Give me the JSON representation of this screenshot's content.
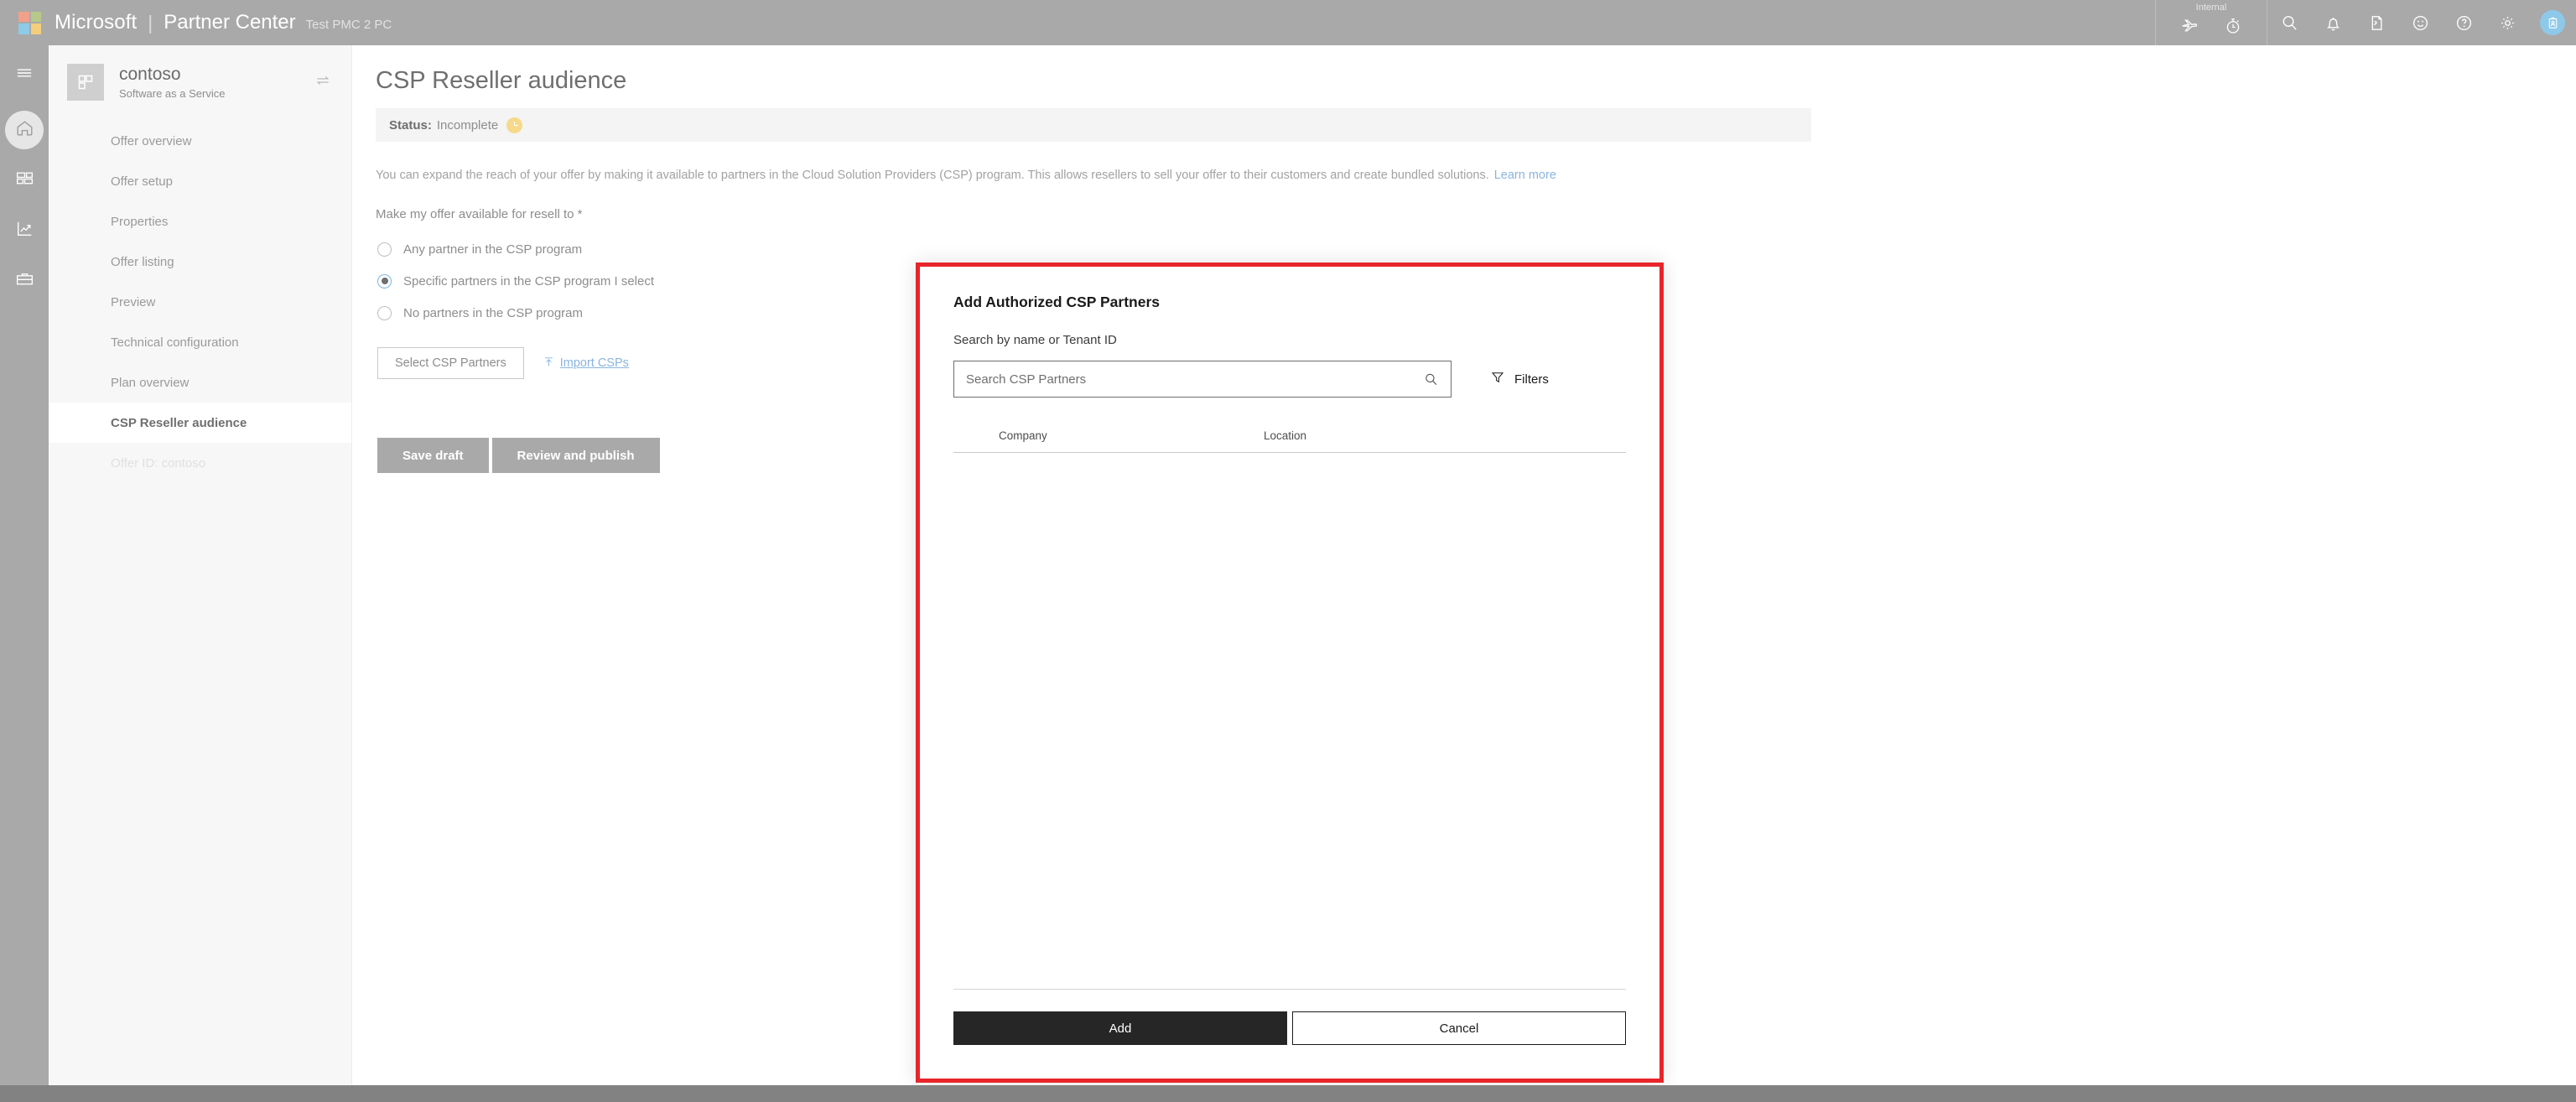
{
  "topbar": {
    "brand_microsoft": "Microsoft",
    "brand_separator": "|",
    "brand_product": "Partner Center",
    "environment": "Test PMC 2 PC",
    "internal_label": "Internal",
    "icons": [
      {
        "name": "airplane-icon",
        "group": "internal"
      },
      {
        "name": "stopwatch-icon",
        "group": "internal"
      },
      {
        "name": "search-icon",
        "group": "main"
      },
      {
        "name": "bell-notification-icon",
        "group": "main"
      },
      {
        "name": "document-feedback-icon",
        "group": "main"
      },
      {
        "name": "smiley-feedback-icon",
        "group": "main"
      },
      {
        "name": "help-question-icon",
        "group": "main"
      },
      {
        "name": "gear-settings-icon",
        "group": "main"
      },
      {
        "name": "avatar-badge-icon",
        "group": "main"
      }
    ]
  },
  "rail": {
    "items": [
      {
        "label": "Menu",
        "icon": "hamburger-menu-icon",
        "active": false
      },
      {
        "label": "Home",
        "icon": "home-icon",
        "active": true
      },
      {
        "label": "Dashboard",
        "icon": "dashboard-grid-icon",
        "active": false
      },
      {
        "label": "Analytics",
        "icon": "analytics-chart-icon",
        "active": false
      },
      {
        "label": "Tools",
        "icon": "toolbox-icon",
        "active": false
      }
    ]
  },
  "sidebar": {
    "offer_name": "contoso",
    "offer_type": "Software as a Service",
    "swap_icon": "swap-arrows-icon",
    "items": [
      {
        "label": "Offer overview",
        "state": "normal"
      },
      {
        "label": "Offer setup",
        "state": "normal"
      },
      {
        "label": "Properties",
        "state": "normal"
      },
      {
        "label": "Offer listing",
        "state": "normal"
      },
      {
        "label": "Preview",
        "state": "normal"
      },
      {
        "label": "Technical configuration",
        "state": "normal"
      },
      {
        "label": "Plan overview",
        "state": "normal"
      },
      {
        "label": "CSP Reseller audience",
        "state": "active"
      },
      {
        "label": "Offer ID: contoso",
        "state": "muted"
      }
    ]
  },
  "main": {
    "page_title": "CSP Reseller audience",
    "header_actions": [
      {
        "label": "Save draft",
        "icon": "save-floppy-icon"
      },
      {
        "label": "Review and publish",
        "icon": "publish-document-icon"
      }
    ],
    "status": {
      "label": "Status:",
      "value": "Incomplete",
      "badge_icon": "pie-progress-icon",
      "badge_color": "#f6d98a"
    },
    "description": "You can expand the reach of your offer by making it available to partners in the Cloud Solution Providers (CSP) program. This allows resellers to sell your offer to their customers and create bundled solutions.",
    "learn_more": "Learn more",
    "field_label": "Make my offer available for resell to *",
    "radio_options": [
      {
        "label": "Any partner in the CSP program",
        "selected": false
      },
      {
        "label": "Specific partners in the CSP program I select",
        "selected": true
      },
      {
        "label": "No partners in the CSP program",
        "selected": false
      }
    ],
    "select_partners_button": "Select CSP Partners",
    "import_csps_link": "Import CSPs",
    "import_icon": "upload-arrow-icon",
    "save_draft_button": "Save draft",
    "review_publish_button": "Review and publish"
  },
  "modal": {
    "title": "Add Authorized CSP Partners",
    "search_label": "Search by name or Tenant ID",
    "search_placeholder": "Search CSP Partners",
    "search_value": "",
    "search_icon": "search-magnifier-icon",
    "filters_label": "Filters",
    "filters_icon": "funnel-filter-icon",
    "table": {
      "columns": [
        "Company",
        "Location"
      ],
      "rows": []
    },
    "add_button": "Add",
    "cancel_button": "Cancel",
    "highlight_color": "#e8252a"
  }
}
